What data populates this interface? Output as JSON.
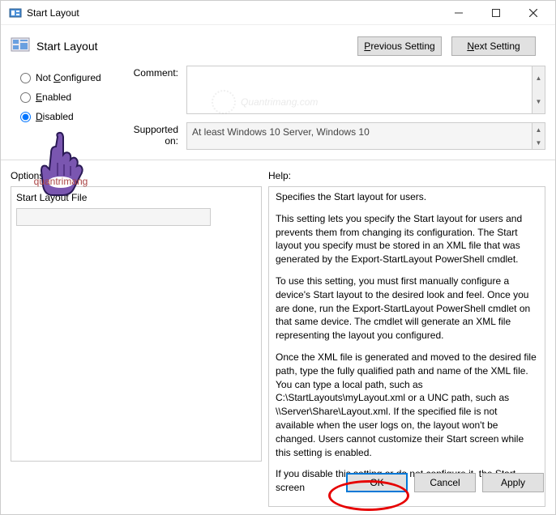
{
  "window": {
    "title": "Start Layout",
    "icon": "layout-icon"
  },
  "header": {
    "title": "Start Layout",
    "prev_btn": "Previous Setting",
    "next_btn": "Next Setting"
  },
  "radios": {
    "not_configured": "Not Configured",
    "enabled": "Enabled",
    "disabled": "Disabled",
    "selected": "disabled"
  },
  "labels": {
    "comment": "Comment:",
    "supported": "Supported on:",
    "options": "Options:",
    "help": "Help:",
    "file_label": "Start Layout File"
  },
  "values": {
    "comment": "",
    "supported": "At least Windows 10 Server, Windows 10",
    "file_value": ""
  },
  "help": {
    "p1": "Specifies the Start layout for users.",
    "p2": "This setting lets you specify the Start layout for users and prevents them from changing its configuration. The Start layout you specify must be stored in an XML file that was generated by the Export-StartLayout PowerShell cmdlet.",
    "p3": "To use this setting, you must first manually configure a device's Start layout to the desired look and feel. Once you are done, run the Export-StartLayout PowerShell cmdlet on that same device. The cmdlet will generate an XML file representing the layout you configured.",
    "p4": "Once the XML file is generated and moved to the desired file path, type the fully qualified path and name of the XML file. You can type a local path, such as C:\\StartLayouts\\myLayout.xml or a UNC path, such as \\\\Server\\Share\\Layout.xml. If the specified file is not available when the user logs on, the layout won't be changed. Users cannot customize their Start screen while this setting is enabled.",
    "p5": "If you disable this setting or do not configure it, the Start screen"
  },
  "footer": {
    "ok": "OK",
    "cancel": "Cancel",
    "apply": "Apply"
  },
  "watermark": "Quantrimang.com"
}
